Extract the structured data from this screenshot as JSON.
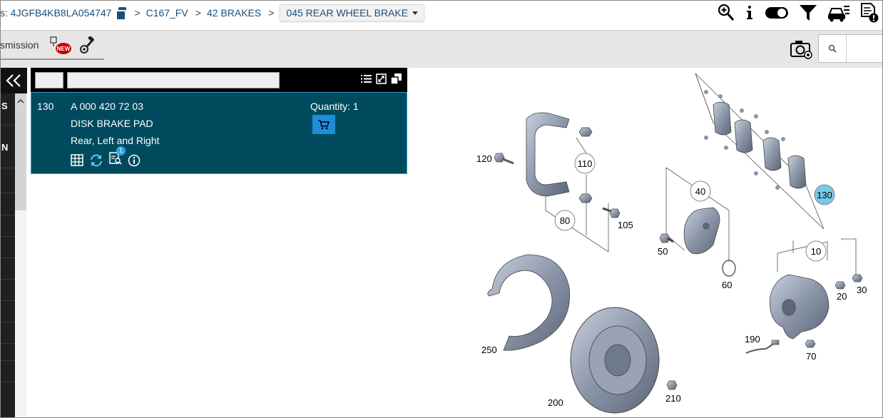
{
  "breadcrumb": {
    "vin_label": "s: 4JGFB4KB8LA054747",
    "items": [
      "C167_FV",
      "42 BRAKES"
    ],
    "separator": ">",
    "current": "045 REAR WHEEL BRAKE"
  },
  "toolbar": {
    "tab_label": "smission",
    "new_badge": "NEW",
    "search_placeholder": ""
  },
  "left_strip": {
    "letters": [
      "S",
      "N"
    ]
  },
  "part": {
    "position": "130",
    "part_number": "A 000 420 72 03",
    "name": "DISK BRAKE PAD",
    "description": "Rear, Left and Right",
    "quantity_label": "Quantity: 1",
    "notes_badge": "1"
  },
  "diagram": {
    "callouts": [
      "120",
      "110",
      "80",
      "105",
      "40",
      "50",
      "60",
      "130",
      "10",
      "20",
      "30",
      "250",
      "190",
      "70",
      "200",
      "210"
    ],
    "highlighted": "130",
    "highlight_color": "#7ac8e8"
  },
  "colors": {
    "panel_bg": "#004a5e",
    "accent": "#1e8fd6",
    "link": "#1a4f7a"
  }
}
